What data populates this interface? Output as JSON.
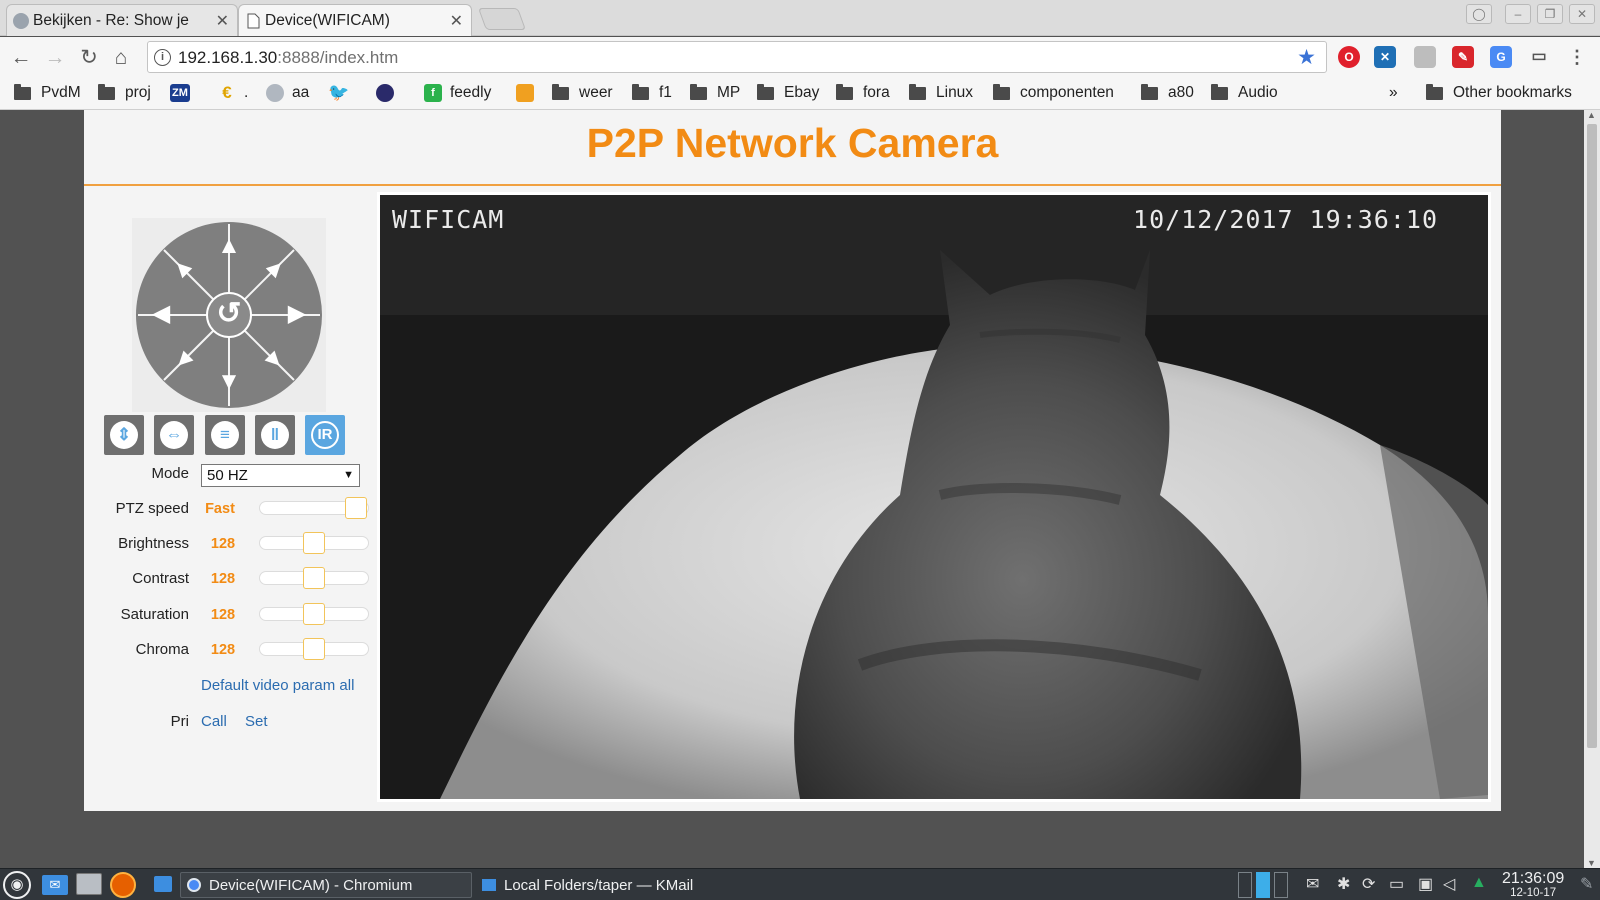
{
  "browser": {
    "tabs": [
      {
        "title": "Bekijken - Re: Show je",
        "active": false
      },
      {
        "title": "Device(WIFICAM)",
        "active": true
      }
    ],
    "url_host": "192.168.1.30",
    "url_path": ":8888/index.htm",
    "bookmarks": [
      {
        "label": "PvdM",
        "icon": "folder-icon"
      },
      {
        "label": "proj",
        "icon": "folder-icon"
      },
      {
        "label": "",
        "icon": "zm-icon"
      },
      {
        "label": ".",
        "icon": "euro-icon"
      },
      {
        "label": "aa",
        "icon": "site-icon"
      },
      {
        "label": "",
        "icon": "twitter-icon"
      },
      {
        "label": "",
        "icon": "site-icon"
      },
      {
        "label": "feedly",
        "icon": "feedly-icon"
      },
      {
        "label": "",
        "icon": "site-icon"
      },
      {
        "label": "weer",
        "icon": "folder-icon"
      },
      {
        "label": "f1",
        "icon": "folder-icon"
      },
      {
        "label": "MP",
        "icon": "folder-icon"
      },
      {
        "label": "Ebay",
        "icon": "folder-icon"
      },
      {
        "label": "fora",
        "icon": "folder-icon"
      },
      {
        "label": "Linux",
        "icon": "folder-icon"
      },
      {
        "label": "componenten",
        "icon": "folder-icon"
      },
      {
        "label": "a80",
        "icon": "folder-icon"
      },
      {
        "label": "Audio",
        "icon": "folder-icon"
      }
    ],
    "bookmarks_overflow": "»",
    "other_bookmarks": "Other bookmarks"
  },
  "camera": {
    "title": "P2P Network Camera",
    "mode_label": "Mode",
    "mode_value": "50 HZ",
    "ptz_speed_label": "PTZ speed",
    "ptz_speed_value": "Fast",
    "ptz_speed_level": 1.0,
    "params": [
      {
        "label": "Brightness",
        "value": "128",
        "level": 0.5
      },
      {
        "label": "Contrast",
        "value": "128",
        "level": 0.5
      },
      {
        "label": "Saturation",
        "value": "128",
        "level": 0.5
      },
      {
        "label": "Chroma",
        "value": "128",
        "level": 0.5
      }
    ],
    "default_link": "Default video param all",
    "pri_label": "Pri",
    "call_link": "Call",
    "set_link": "Set",
    "ir_label": "IR",
    "video_label": "WIFICAM",
    "video_timestamp": "10/12/2017  19:36:10"
  },
  "taskbar": {
    "tasks": [
      {
        "label": "Device(WIFICAM) - Chromium",
        "active": true
      },
      {
        "label": "Local Folders/taper — KMail",
        "active": false
      }
    ],
    "clock_time": "21:36:09",
    "clock_date": "12-10-17"
  },
  "colors": {
    "accent": "#f28b14",
    "link": "#2b6cb0",
    "ir": "#5aa6e0"
  }
}
